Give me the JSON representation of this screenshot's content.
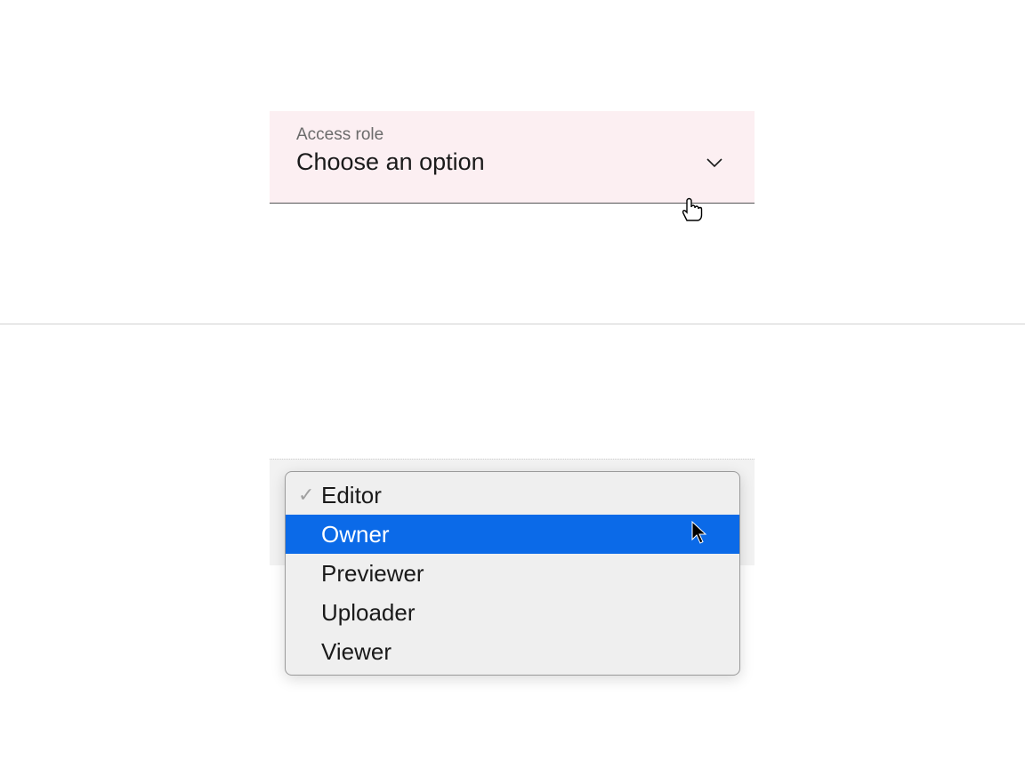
{
  "dropdown": {
    "label": "Access role",
    "placeholder": "Choose an option",
    "options": [
      {
        "label": "Editor",
        "selected": true,
        "highlighted": false
      },
      {
        "label": "Owner",
        "selected": false,
        "highlighted": true
      },
      {
        "label": "Previewer",
        "selected": false,
        "highlighted": false
      },
      {
        "label": "Uploader",
        "selected": false,
        "highlighted": false
      },
      {
        "label": "Viewer",
        "selected": false,
        "highlighted": false
      }
    ]
  },
  "icons": {
    "chevron_down": "chevron-down-icon",
    "check": "✓"
  },
  "colors": {
    "field_bg": "#fceff2",
    "highlight": "#0b6ae8"
  }
}
